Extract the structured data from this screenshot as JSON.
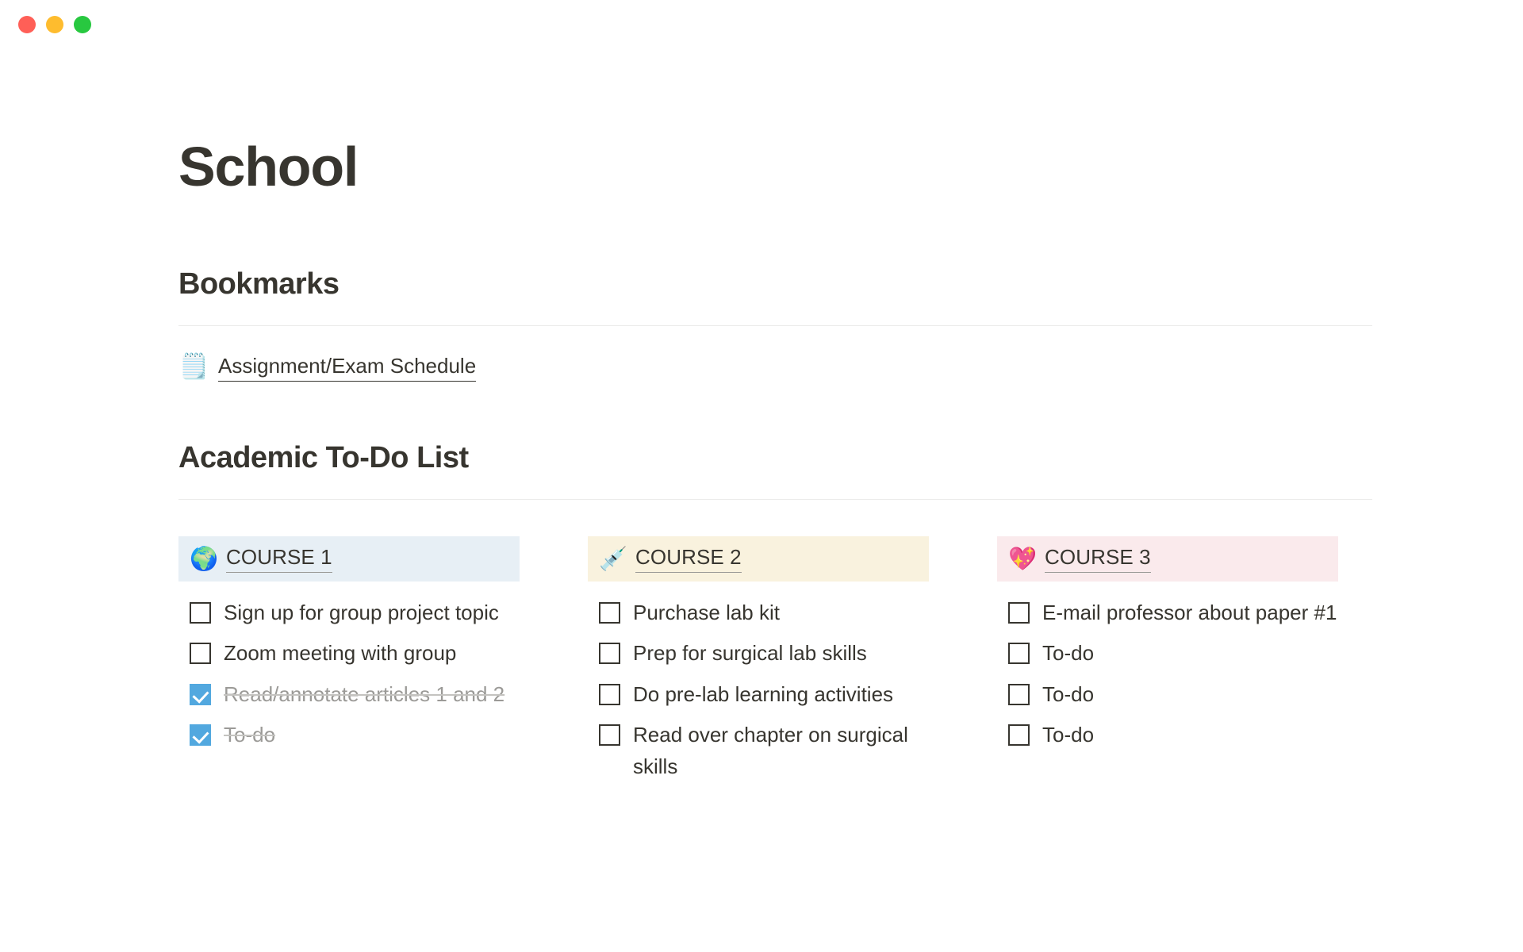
{
  "window": {
    "traffic_lights": [
      {
        "name": "close",
        "color": "#FF5F57"
      },
      {
        "name": "minimize",
        "color": "#FEBC2E"
      },
      {
        "name": "maximize",
        "color": "#28C840"
      }
    ]
  },
  "page": {
    "title": "School"
  },
  "bookmarks": {
    "heading": "Bookmarks",
    "items": [
      {
        "emoji": "🗒️",
        "icon_name": "spiral-notepad-icon",
        "label": "Assignment/Exam Schedule"
      }
    ]
  },
  "todo": {
    "heading": "Academic To-Do List",
    "columns": [
      {
        "emoji": "🌍",
        "icon_name": "globe-showing-europe-africa-icon",
        "name": "COURSE 1",
        "header_color": "#E7EFF5",
        "items": [
          {
            "label": "Sign up for group project topic",
            "checked": false
          },
          {
            "label": "Zoom meeting with group",
            "checked": false
          },
          {
            "label": "Read/annotate articles 1 and 2",
            "checked": true
          },
          {
            "label": "To-do",
            "checked": true
          }
        ]
      },
      {
        "emoji": "💉",
        "icon_name": "syringe-icon",
        "name": "COURSE 2",
        "header_color": "#F9F2DE",
        "items": [
          {
            "label": "Purchase lab kit",
            "checked": false
          },
          {
            "label": "Prep for surgical lab skills",
            "checked": false
          },
          {
            "label": "Do pre-lab learning activities",
            "checked": false
          },
          {
            "label": "Read over chapter on surgical skills",
            "checked": false
          }
        ]
      },
      {
        "emoji": "💖",
        "icon_name": "sparkling-heart-icon",
        "name": "COURSE 3",
        "header_color": "#FAEAEC",
        "items": [
          {
            "label": "E-mail professor about paper #1",
            "checked": false
          },
          {
            "label": "To-do",
            "checked": false
          },
          {
            "label": "To-do",
            "checked": false
          },
          {
            "label": "To-do",
            "checked": false
          }
        ]
      }
    ]
  }
}
